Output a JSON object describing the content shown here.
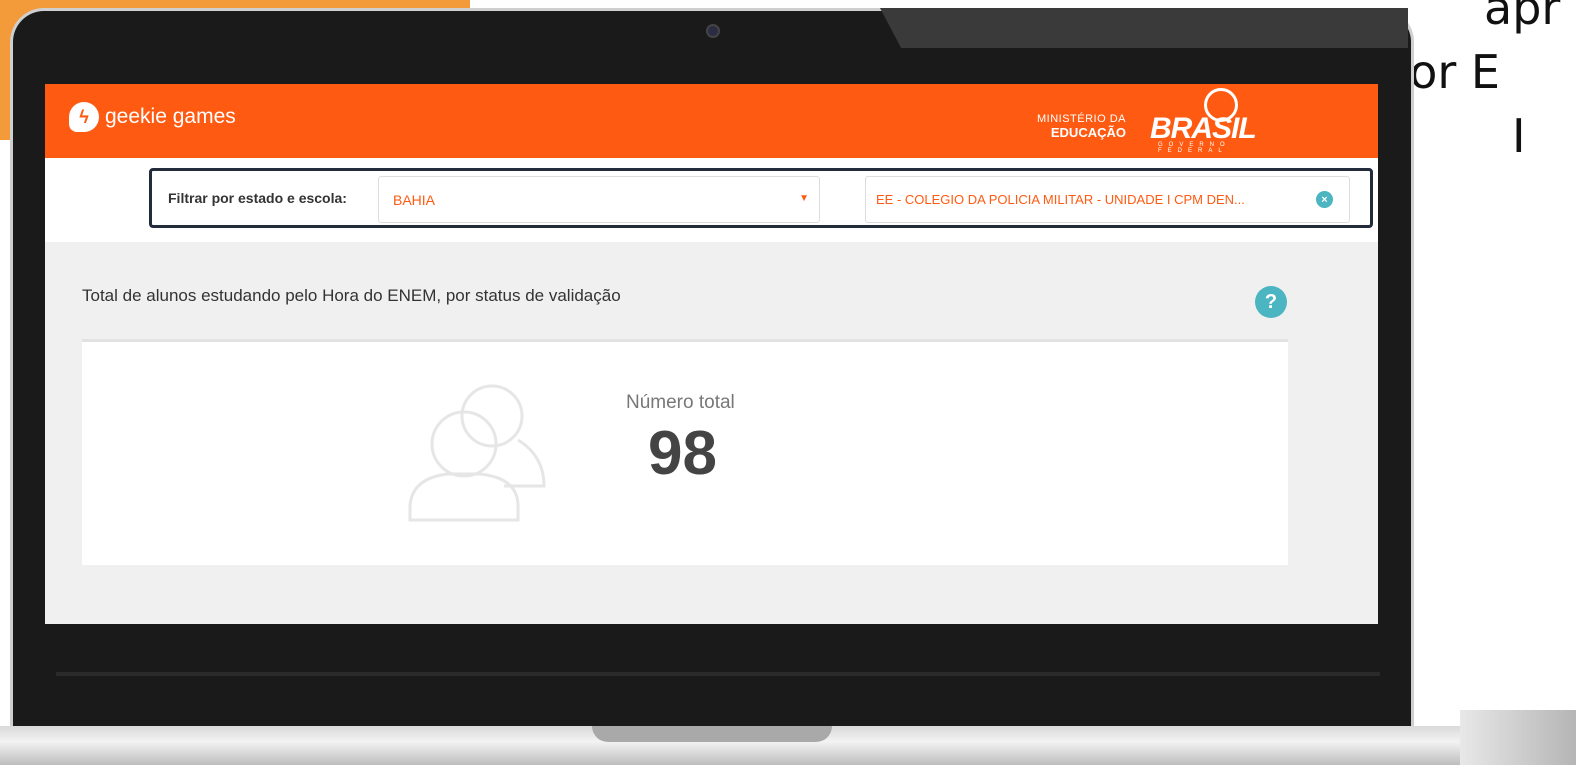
{
  "caption": {
    "lines": [
      "apr",
      "por E",
      "I"
    ]
  },
  "app": {
    "brand": "geekie games",
    "ministry_line1": "MINISTÉRIO DA",
    "ministry_line2": "EDUCAÇÃO",
    "gov_word": "BRASIL",
    "gov_sub": "GOVERNO FEDERAL"
  },
  "filter": {
    "label": "Filtrar por estado e escola:",
    "state_value": "BAHIA",
    "school_value": "EE - COLEGIO DA POLICIA MILITAR - UNIDADE I CPM DEN...",
    "clear_icon": "close-icon"
  },
  "section": {
    "title": "Total de alunos estudando pelo Hora do ENEM, por status de validação",
    "help_glyph": "?"
  },
  "stat": {
    "label": "Número total",
    "value": "98",
    "icon": "users-icon"
  },
  "colors": {
    "brand_orange": "#ff5a12",
    "accent_teal": "#4bb5c1"
  }
}
